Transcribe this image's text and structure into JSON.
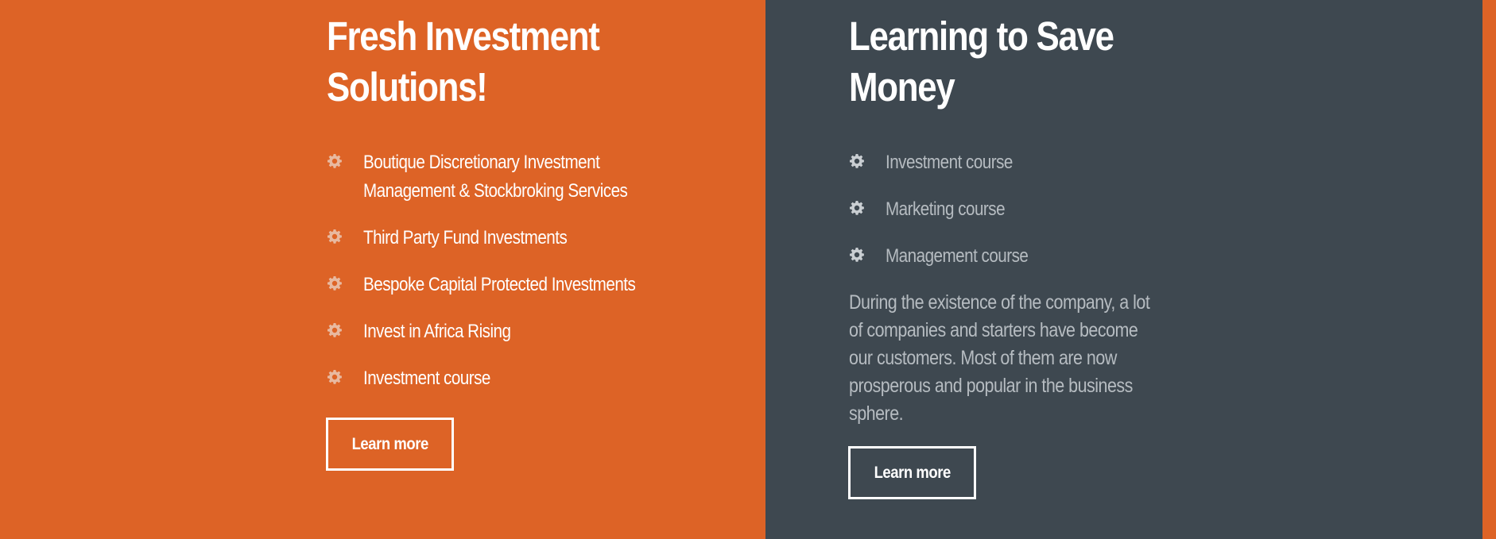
{
  "colors": {
    "orange": "#dd6326",
    "slate": "#3e4850",
    "muted_text": "#b6bcc1",
    "white": "#ffffff"
  },
  "left_panel": {
    "title_line1": "Fresh Investment",
    "title_line2": "Solutions!",
    "items": [
      {
        "icon": "gear-icon",
        "line1": "Boutique Discretionary Investment",
        "line2": "Management & Stockbroking Services"
      },
      {
        "icon": "gear-icon",
        "line1": "Third Party Fund Investments"
      },
      {
        "icon": "gear-icon",
        "line1": "Bespoke Capital Protected Investments"
      },
      {
        "icon": "gear-icon",
        "line1": "Invest in Africa Rising"
      },
      {
        "icon": "gear-icon",
        "line1": "Investment course"
      }
    ],
    "button_label": "Learn more"
  },
  "right_panel": {
    "title_line1": "Learning to Save",
    "title_line2": "Money",
    "items": [
      {
        "icon": "gear-icon",
        "line1": "Investment course"
      },
      {
        "icon": "gear-icon",
        "line1": "Marketing course"
      },
      {
        "icon": "gear-icon",
        "line1": "Management course"
      }
    ],
    "description_lines": [
      "During the existence of the company, a lot",
      "of companies and starters have become",
      "our customers. Most of them are now",
      "prosperous and popular in the business",
      "sphere."
    ],
    "button_label": "Learn more"
  }
}
